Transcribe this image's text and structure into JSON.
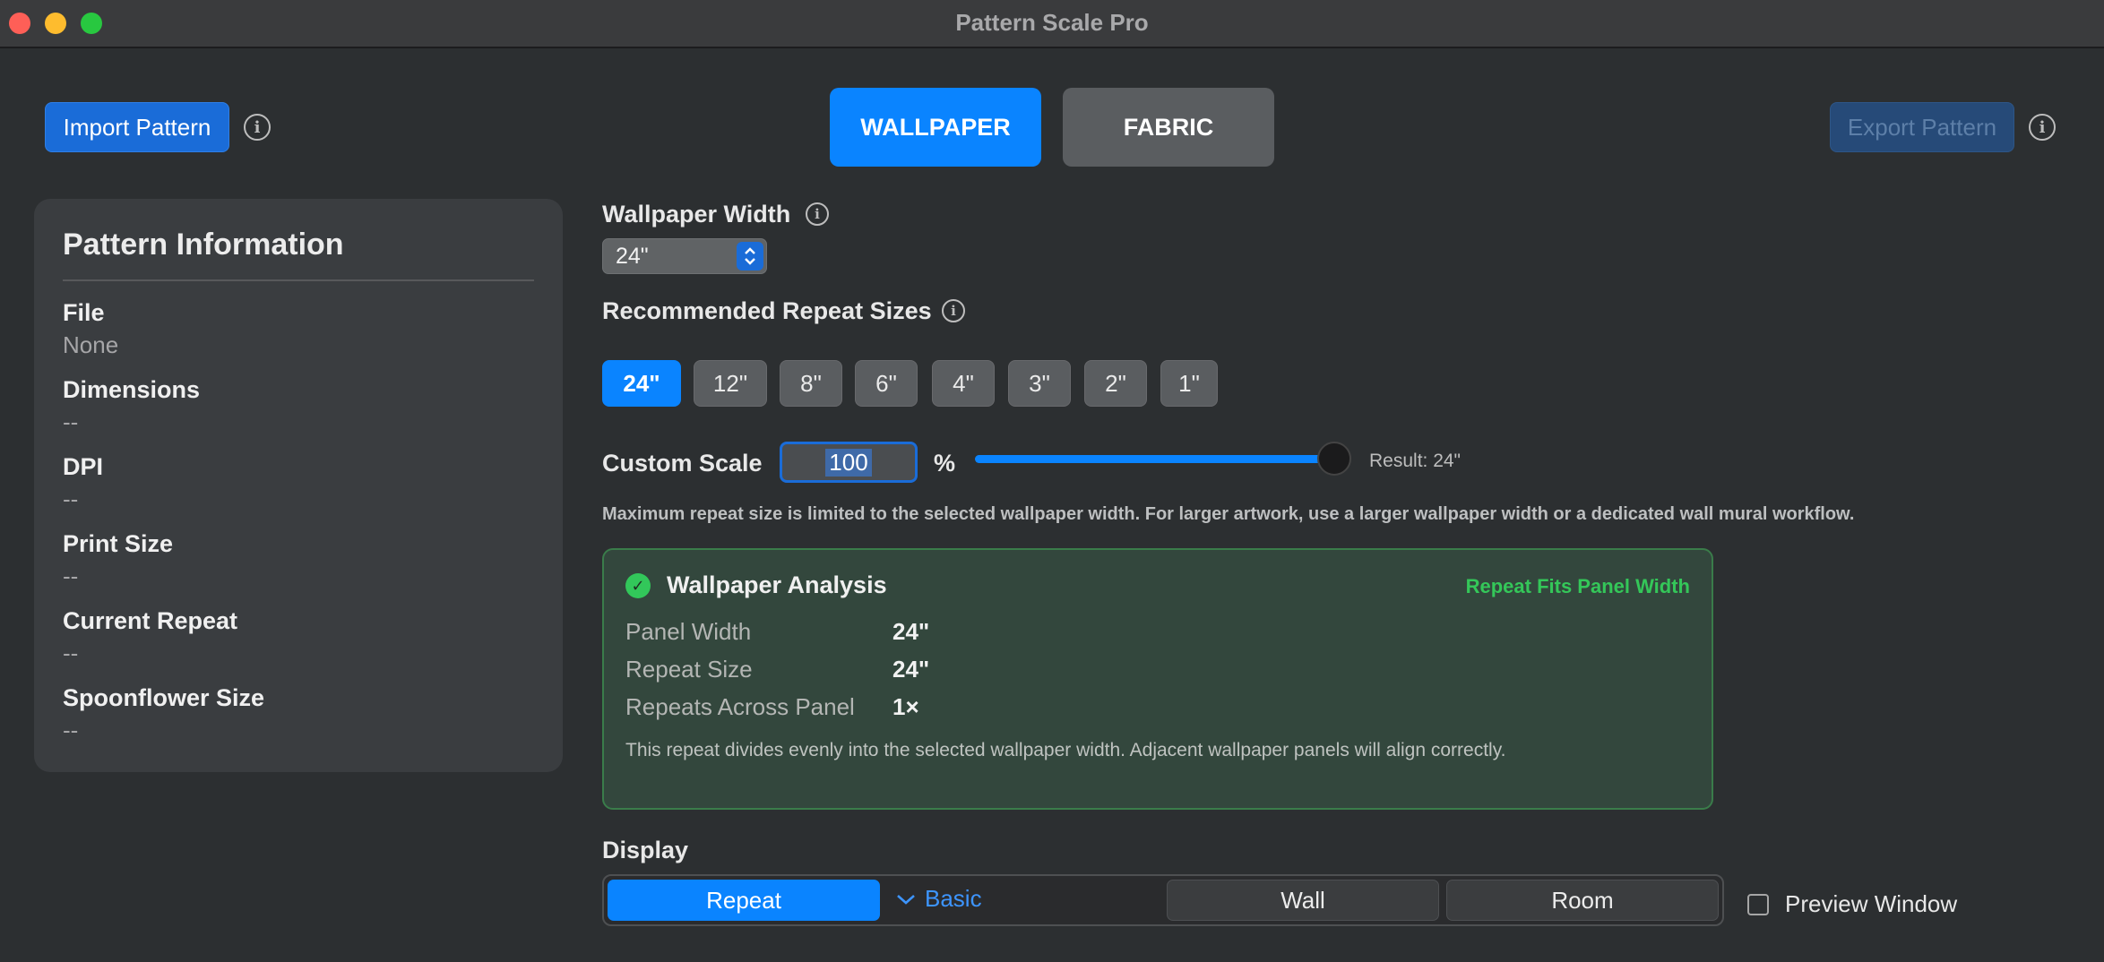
{
  "window": {
    "title": "Pattern Scale Pro"
  },
  "header": {
    "import_label": "Import Pattern",
    "export_label": "Export Pattern",
    "tabs": [
      {
        "label": "WALLPAPER",
        "active": true
      },
      {
        "label": "FABRIC",
        "active": false
      }
    ]
  },
  "info_panel": {
    "title": "Pattern Information",
    "fields": [
      {
        "label": "File",
        "value": "None"
      },
      {
        "label": "Dimensions",
        "value": "--"
      },
      {
        "label": "DPI",
        "value": "--"
      },
      {
        "label": "Print Size",
        "value": "--"
      },
      {
        "label": "Current Repeat",
        "value": "--"
      },
      {
        "label": "Spoonflower Size",
        "value": "--"
      }
    ]
  },
  "wallpaper_width": {
    "label": "Wallpaper Width",
    "value": "24\""
  },
  "repeat_sizes": {
    "label": "Recommended Repeat Sizes",
    "options": [
      "24\"",
      "12\"",
      "8\"",
      "6\"",
      "4\"",
      "3\"",
      "2\"",
      "1\""
    ],
    "selected": "24\""
  },
  "custom_scale": {
    "label": "Custom Scale",
    "value": "100",
    "unit": "%",
    "slider_fraction": 1.0,
    "result": "Result: 24\""
  },
  "limit_note": "Maximum repeat size is limited to the selected wallpaper width. For larger artwork, use a larger wallpaper width or a dedicated wall mural workflow.",
  "analysis": {
    "title": "Wallpaper Analysis",
    "status": "Repeat Fits Panel Width",
    "rows": [
      {
        "label": "Panel Width",
        "value": "24\""
      },
      {
        "label": "Repeat Size",
        "value": "24\""
      },
      {
        "label": "Repeats Across Panel",
        "value": "1×"
      }
    ],
    "note": "This repeat divides evenly into the selected wallpaper width. Adjacent wallpaper panels will align correctly."
  },
  "display": {
    "label": "Display",
    "repeat_label": "Repeat",
    "basic_label": "Basic",
    "wall_label": "Wall",
    "room_label": "Room",
    "preview_label": "Preview Window",
    "preview_checked": false
  },
  "colors": {
    "accent": "#0a84ff",
    "success": "#34c759",
    "background": "#2c2f31"
  }
}
